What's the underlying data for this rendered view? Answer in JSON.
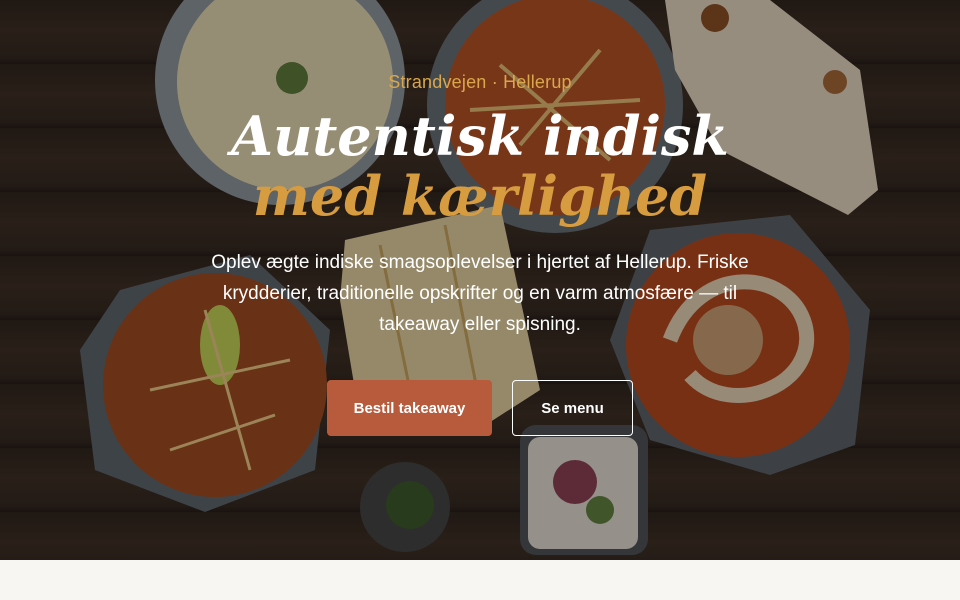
{
  "hero": {
    "eyebrow": "Strandvejen · Hellerup",
    "title_line1": "Autentisk indisk",
    "title_line2": "med kærlighed",
    "lead": "Oplev ægte indiske smagsoplevelser i hjertet af Hellerup. Friske krydderier, traditionelle opskrifter og en varm atmosfære — til takeaway eller spisning.",
    "primary_cta": "Bestil takeaway",
    "secondary_cta": "Se menu",
    "background_image": "indian-food-table-photo"
  },
  "colors": {
    "accent_gold": "#d79c3f",
    "eyebrow_gold": "#d9a84c",
    "primary_button": "#b85a3c",
    "below_section": "#f8f6f2"
  }
}
